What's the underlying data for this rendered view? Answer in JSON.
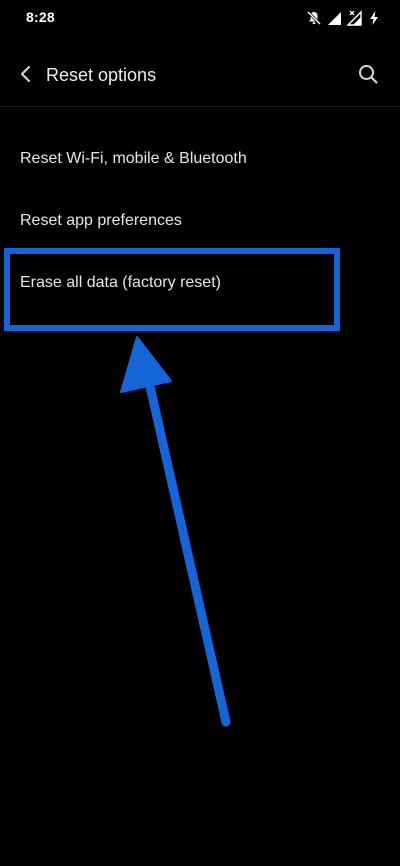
{
  "status_bar": {
    "time": "8:28",
    "icons": [
      "bell-muted-icon",
      "signal-icon",
      "signal-no-data-icon",
      "charging-icon"
    ]
  },
  "app_bar": {
    "title": "Reset options",
    "back_icon": "chevron-left-icon",
    "search_icon": "search-icon"
  },
  "menu": {
    "items": [
      {
        "label": "Reset Wi-Fi, mobile & Bluetooth"
      },
      {
        "label": "Reset app preferences"
      },
      {
        "label": "Erase all data (factory reset)"
      }
    ]
  },
  "annotation": {
    "color": "#1565d8",
    "highlighted_item": "Erase all data (factory reset)"
  }
}
